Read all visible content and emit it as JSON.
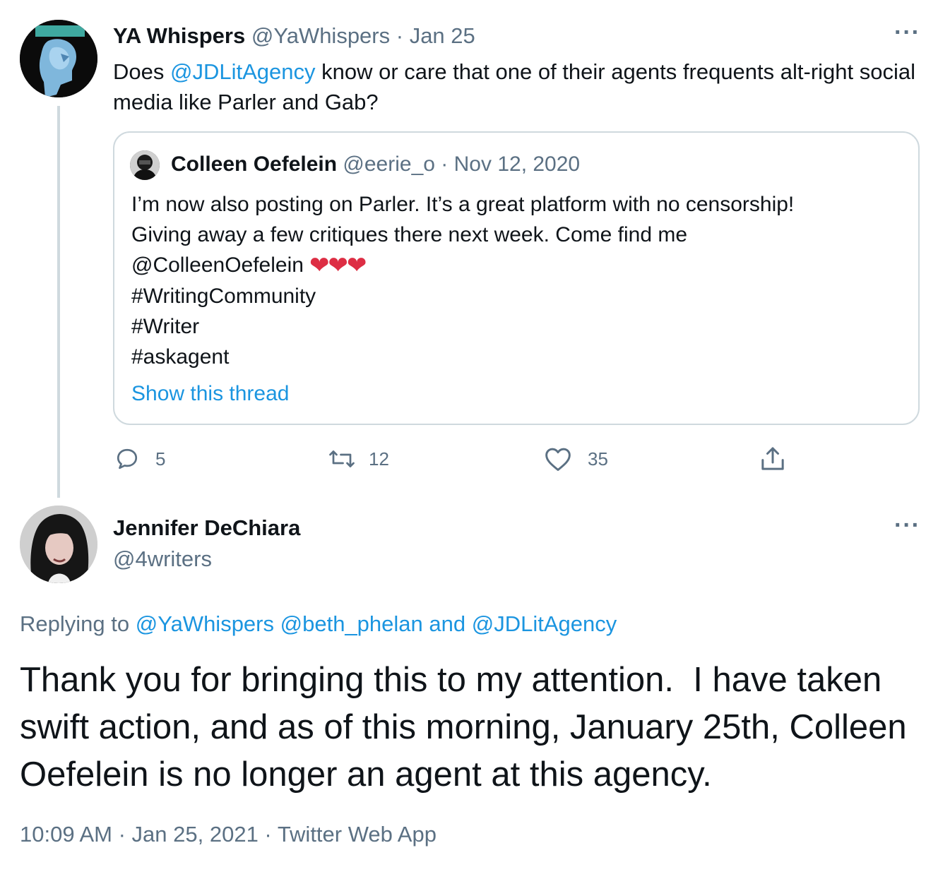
{
  "tweet1": {
    "display_name": "YA Whispers",
    "handle": "@YaWhispers",
    "sep": " · ",
    "date": "Jan 25",
    "more_icon": "more-icon",
    "text_before": "Does ",
    "mention": "@JDLitAgency",
    "text_after": " know or care that one of their agents frequents alt-right social media like Parler and Gab?",
    "quoted": {
      "display_name": "Colleen Oefelein",
      "handle": "@eerie_o",
      "sep": " · ",
      "date": "Nov 12, 2020",
      "line1": "I’m now also posting on Parler. It’s a great platform with no censorship!",
      "line2": "Giving away a few critiques there next week. Come find me",
      "line3": "@ColleenOefelein",
      "hearts": "❤❤❤",
      "hashtag1": "#WritingCommunity",
      "hashtag2": "#Writer",
      "hashtag3": "#askagent",
      "show_thread": "Show this thread"
    },
    "actions": {
      "reply_count": "5",
      "retweet_count": "12",
      "like_count": "35",
      "icons": [
        "reply-icon",
        "retweet-icon",
        "like-icon",
        "share-icon"
      ]
    }
  },
  "tweet2": {
    "display_name": "Jennifer DeChiara",
    "handle": "@4writers",
    "more_icon": "more-icon",
    "replying_prefix": "Replying to ",
    "replying_mention1": "@YaWhispers",
    "replying_space": " ",
    "replying_mention2": "@beth_phelan",
    "replying_and": " and ",
    "replying_mention3": "@JDLitAgency",
    "text": "Thank you for bringing this to my attention.  I have taken swift action, and as of this morning, January 25th, Colleen Oefelein is no longer an agent at this agency.",
    "time": "10:09 AM",
    "sep1": " · ",
    "date": "Jan 25, 2021",
    "sep2": " · ",
    "source": "Twitter Web App"
  },
  "colors": {
    "link": "#1b95e0",
    "muted": "#5b7083",
    "text": "#0f1419",
    "border": "#cfd9de",
    "heart": "#dd2e44"
  }
}
